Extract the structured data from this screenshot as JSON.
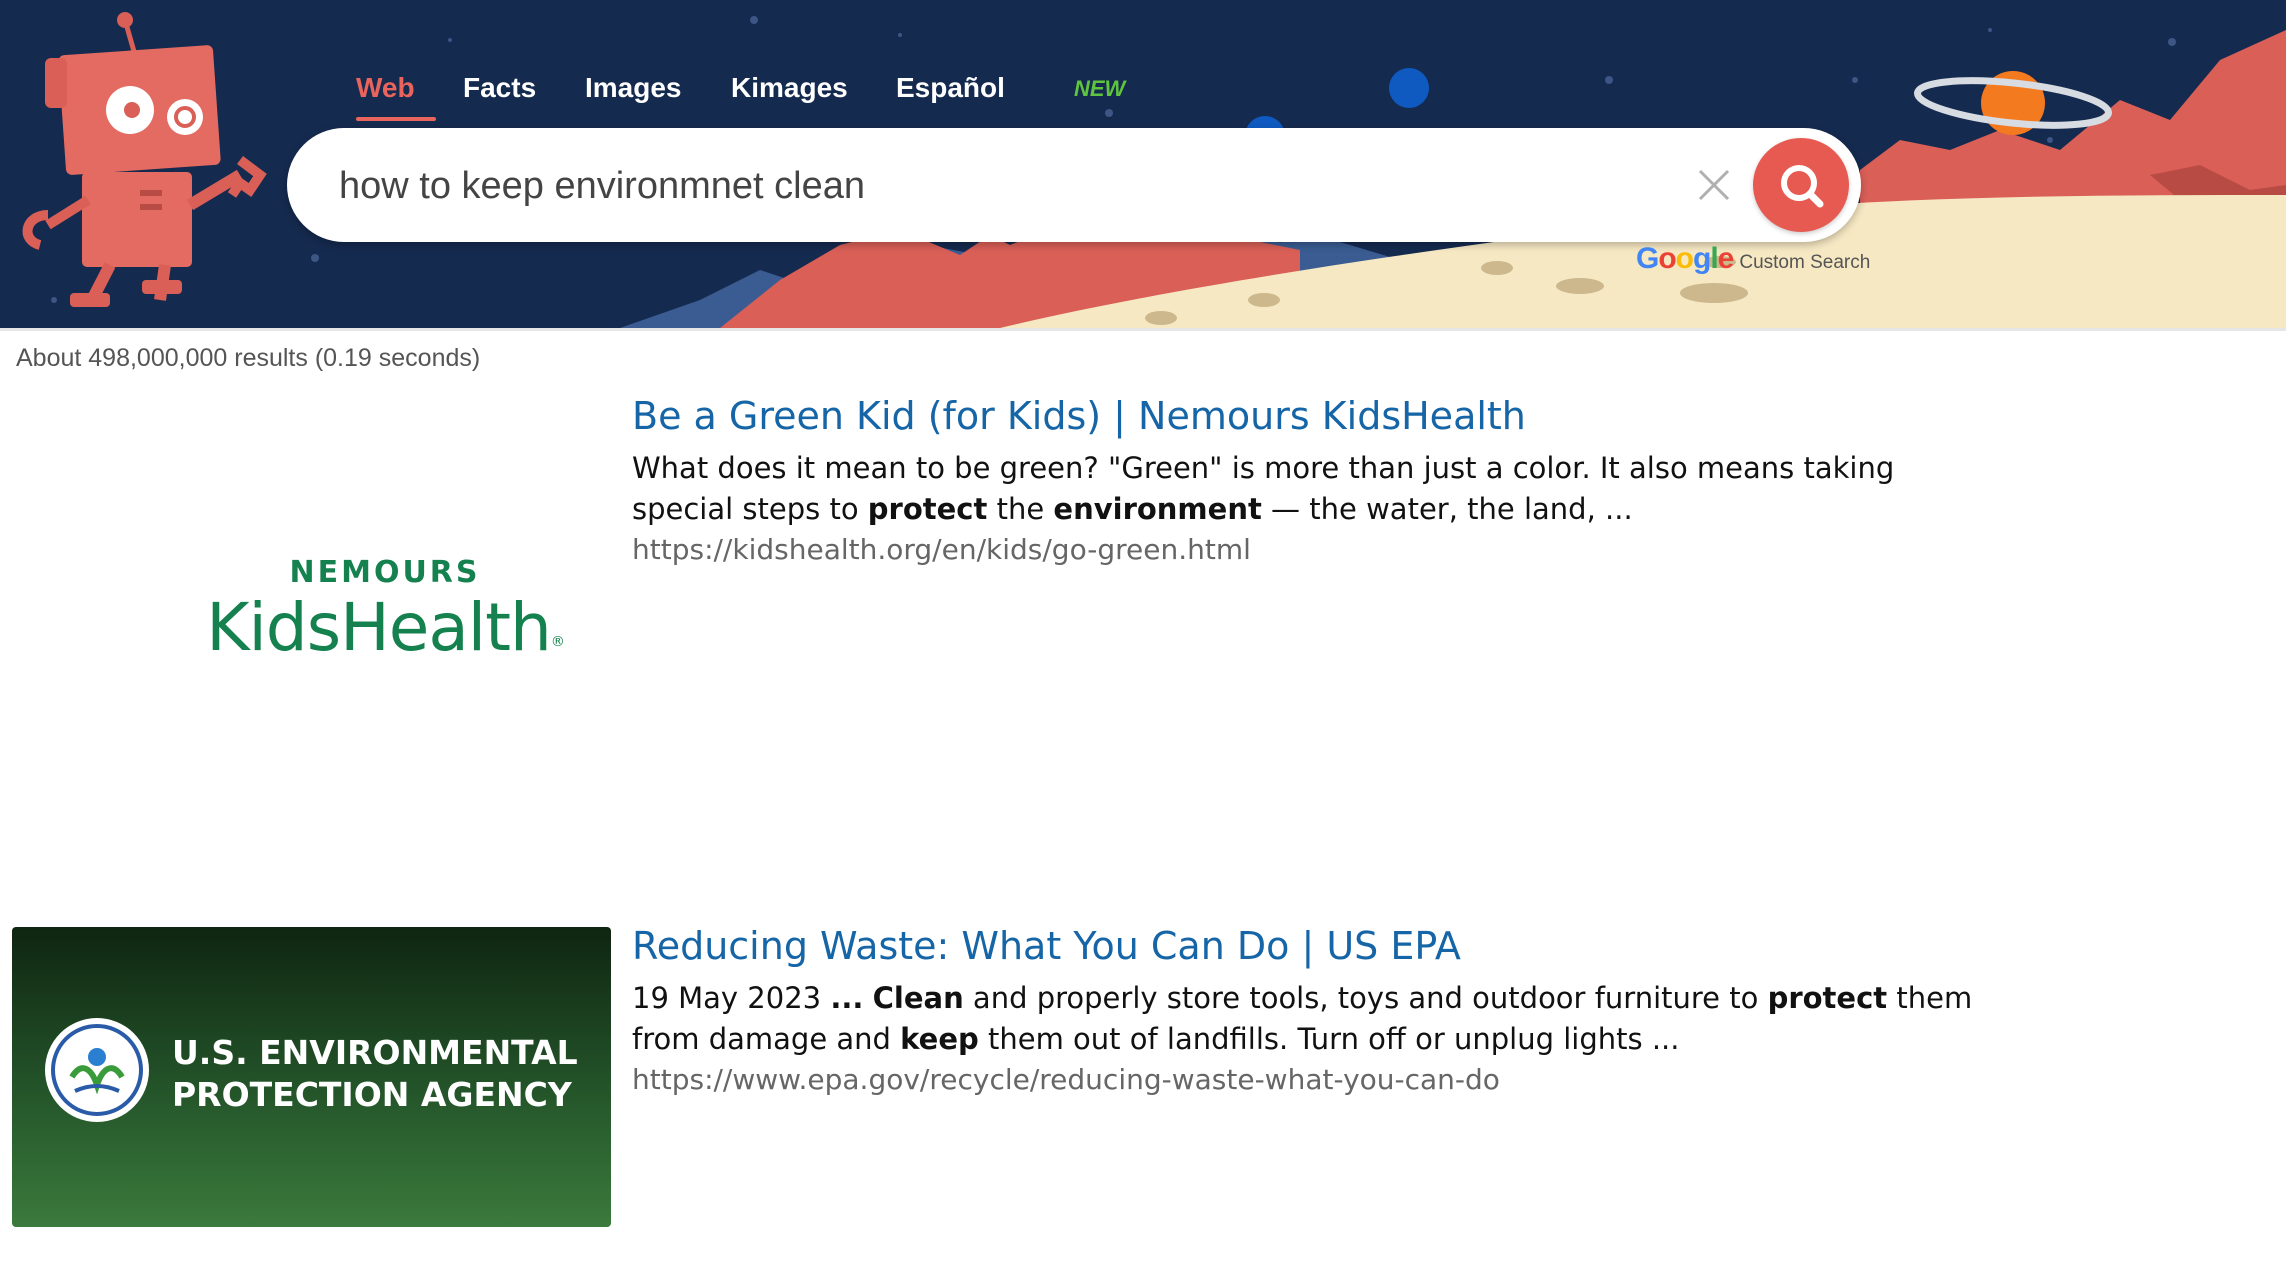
{
  "nav": {
    "tabs": [
      {
        "label": "Web",
        "active": true
      },
      {
        "label": "Facts"
      },
      {
        "label": "Images"
      },
      {
        "label": "Kimages"
      },
      {
        "label": "Español",
        "badge": "NEW"
      }
    ]
  },
  "search": {
    "query": "how to keep environmnet clean",
    "attribution_logo": "Google",
    "attribution_text": "Custom Search"
  },
  "stats": "About 498,000,000 results (0.19 seconds)",
  "results": [
    {
      "title": "Be a Green Kid (for Kids) | Nemours KidsHealth",
      "snippet_parts": [
        {
          "text": "What does it mean to be green? \"Green\" is more than just a color. It also means taking special steps to "
        },
        {
          "text": "protect",
          "bold": true
        },
        {
          "text": " the "
        },
        {
          "text": "environment",
          "bold": true
        },
        {
          "text": " — the water, the land, ..."
        }
      ],
      "url": "https://kidshealth.org/en/kids/go-green.html",
      "thumb": {
        "line1": "NEMOURS",
        "line2": "KidsHealth",
        "registered": "®"
      }
    },
    {
      "title": "Reducing Waste: What You Can Do | US EPA",
      "snippet_parts": [
        {
          "text": "19 May 2023 "
        },
        {
          "text": "...",
          "bold": true
        },
        {
          "text": " "
        },
        {
          "text": "Clean",
          "bold": true
        },
        {
          "text": " and properly store tools, toys and outdoor furniture to "
        },
        {
          "text": "protect",
          "bold": true
        },
        {
          "text": " them from damage and "
        },
        {
          "text": "keep",
          "bold": true
        },
        {
          "text": " them out of landfills. Turn off or unplug lights ..."
        }
      ],
      "url": "https://www.epa.gov/recycle/reducing-waste-what-you-can-do",
      "thumb": {
        "line1": "U.S. ENVIRONMENTAL",
        "line2": "PROTECTION AGENCY"
      }
    }
  ],
  "colors": {
    "header_bg": "#152a4f",
    "accent": "#e9645c",
    "link": "#1565a7",
    "url": "#666666",
    "new_badge": "#5fc43f"
  },
  "icons": [
    "robot-mascot-icon",
    "planet-icon",
    "clear-x-icon",
    "search-magnifier-icon",
    "epa-seal-icon"
  ]
}
